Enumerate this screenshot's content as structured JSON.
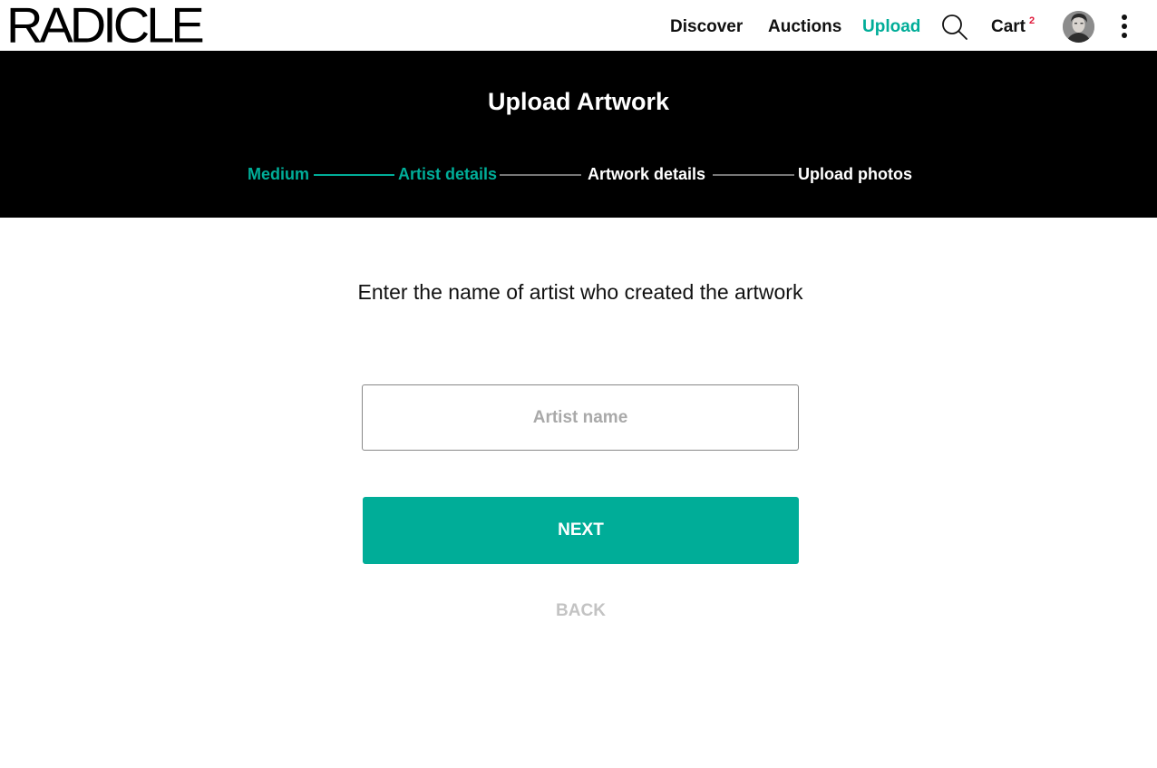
{
  "brand": {
    "logo_text": "RADICLE"
  },
  "nav": {
    "discover": "Discover",
    "auctions": "Auctions",
    "upload": "Upload",
    "search_icon": "search-icon",
    "cart": "Cart",
    "cart_count": "2",
    "avatar": "user-avatar",
    "menu_icon": "kebab-menu-icon"
  },
  "header": {
    "title": "Upload Artwork",
    "steps": [
      {
        "label": "Medium",
        "status": "complete"
      },
      {
        "label": "Artist details",
        "status": "current"
      },
      {
        "label": "Artwork details",
        "status": "upcoming"
      },
      {
        "label": "Upload photos",
        "status": "upcoming"
      }
    ]
  },
  "form": {
    "prompt": "Enter the name of artist who created the artwork",
    "artist_input": {
      "value": "",
      "placeholder": "Artist name"
    },
    "next_label": "NEXT",
    "back_label": "BACK"
  },
  "colors": {
    "accent": "#00ad98",
    "header_bg": "#000000",
    "cart_badge": "#e0193a",
    "back_disabled": "#c3c3c3"
  }
}
